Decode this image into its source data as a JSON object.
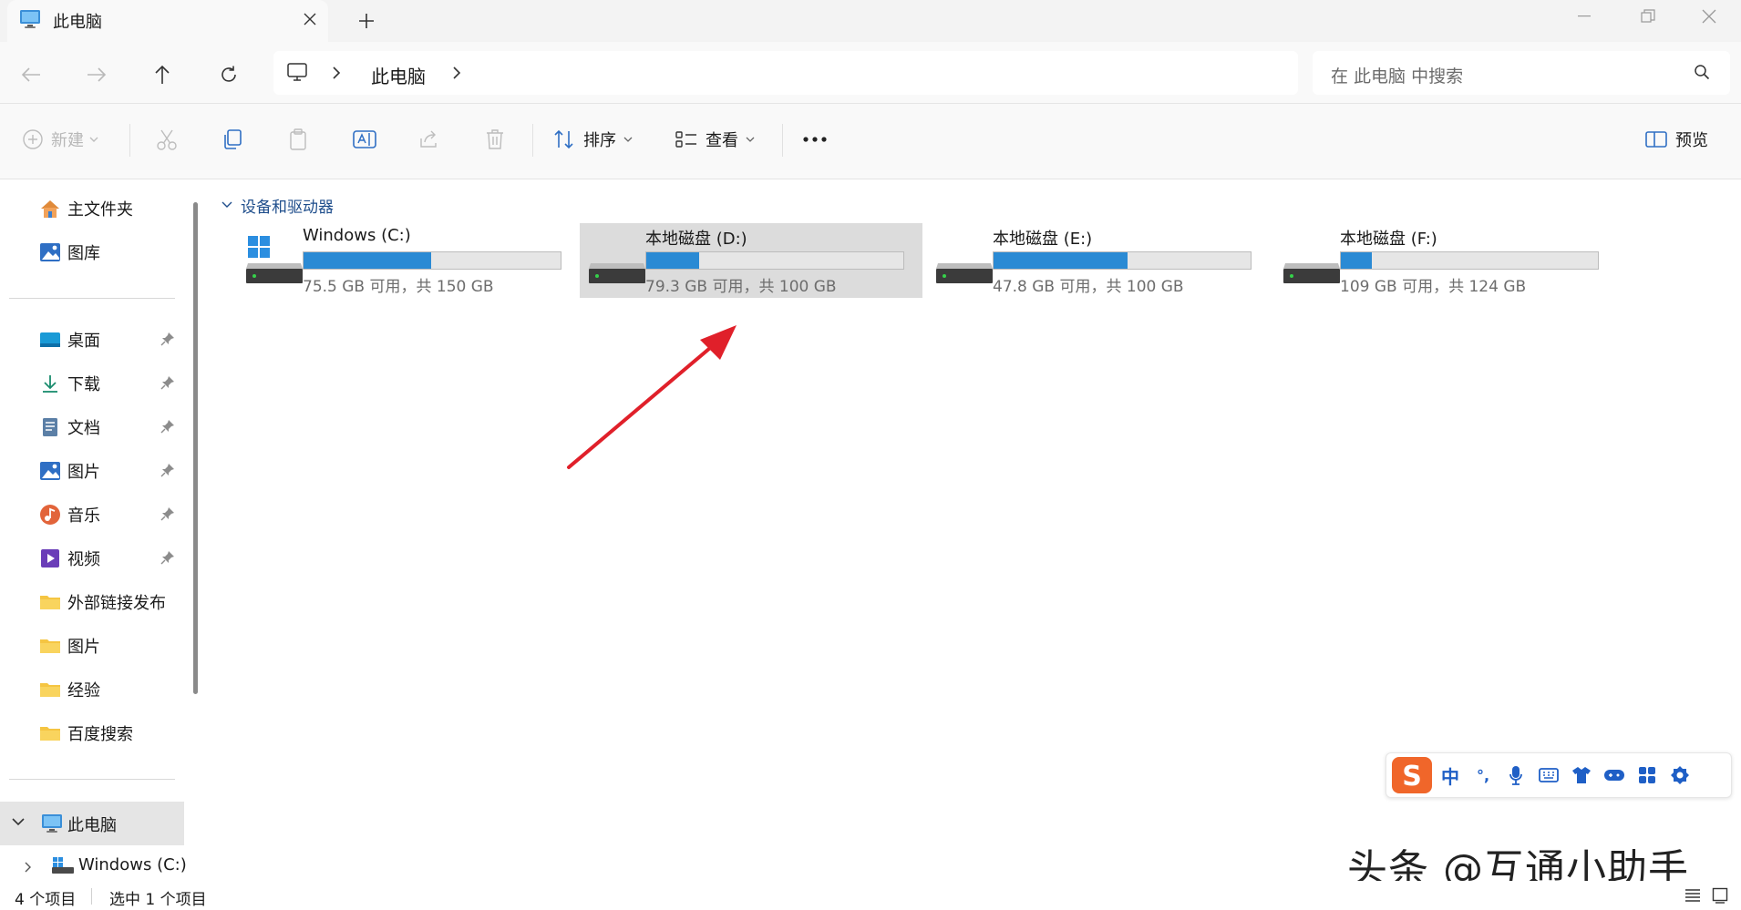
{
  "window": {
    "tab_title": "此电脑",
    "tab_icon": "monitor-icon",
    "new_tab_symbol": "+"
  },
  "address_bar": {
    "breadcrumb": "此电脑",
    "search_placeholder": "在 此电脑 中搜索"
  },
  "command_bar": {
    "new_label": "新建",
    "sort_label": "排序",
    "view_label": "查看",
    "more_label": "···",
    "preview_label": "预览"
  },
  "sidebar": {
    "top_items": [
      {
        "label": "主文件夹",
        "icon": "home-icon"
      },
      {
        "label": "图库",
        "icon": "gallery-icon"
      }
    ],
    "quick_access": [
      {
        "label": "桌面",
        "icon": "desktop-icon",
        "pinned": true
      },
      {
        "label": "下载",
        "icon": "download-icon",
        "pinned": true
      },
      {
        "label": "文档",
        "icon": "document-icon",
        "pinned": true
      },
      {
        "label": "图片",
        "icon": "pictures-icon",
        "pinned": true
      },
      {
        "label": "音乐",
        "icon": "music-icon",
        "pinned": true
      },
      {
        "label": "视频",
        "icon": "video-icon",
        "pinned": true
      },
      {
        "label": "外部链接发布",
        "icon": "folder-icon",
        "pinned": false
      },
      {
        "label": "图片",
        "icon": "folder-icon",
        "pinned": false
      },
      {
        "label": "经验",
        "icon": "folder-icon",
        "pinned": false
      },
      {
        "label": "百度搜索",
        "icon": "folder-icon",
        "pinned": false
      }
    ],
    "this_pc_label": "此电脑",
    "this_pc_child": "Windows (C:)"
  },
  "content": {
    "group_label": "设备和驱动器",
    "drives": [
      {
        "name": "Windows (C:)",
        "info": "75.5 GB 可用，共 150 GB",
        "used_fraction": 0.497,
        "selected": false,
        "os_drive": true
      },
      {
        "name": "本地磁盘 (D:)",
        "info": "79.3 GB 可用，共 100 GB",
        "used_fraction": 0.207,
        "selected": true,
        "os_drive": false
      },
      {
        "name": "本地磁盘 (E:)",
        "info": "47.8 GB 可用，共 100 GB",
        "used_fraction": 0.522,
        "selected": false,
        "os_drive": false
      },
      {
        "name": "本地磁盘 (F:)",
        "info": "109 GB 可用，共 124 GB",
        "used_fraction": 0.121,
        "selected": false,
        "os_drive": false
      }
    ]
  },
  "ime_toolbar": {
    "logo": "S",
    "mode": "中",
    "punct": "°,",
    "icons": [
      "microphone-icon",
      "keyboard-icon",
      "shirt-icon",
      "gamepad-icon",
      "apps-icon",
      "settings-icon"
    ]
  },
  "watermark": "头条 @互通小助手",
  "status_bar": {
    "item_count": "4 个项目",
    "selected_count": "选中 1 个项目"
  },
  "colors": {
    "accent": "#2a8ad4",
    "selected_bg": "#dcdcdc",
    "arrow": "#e0202a"
  }
}
